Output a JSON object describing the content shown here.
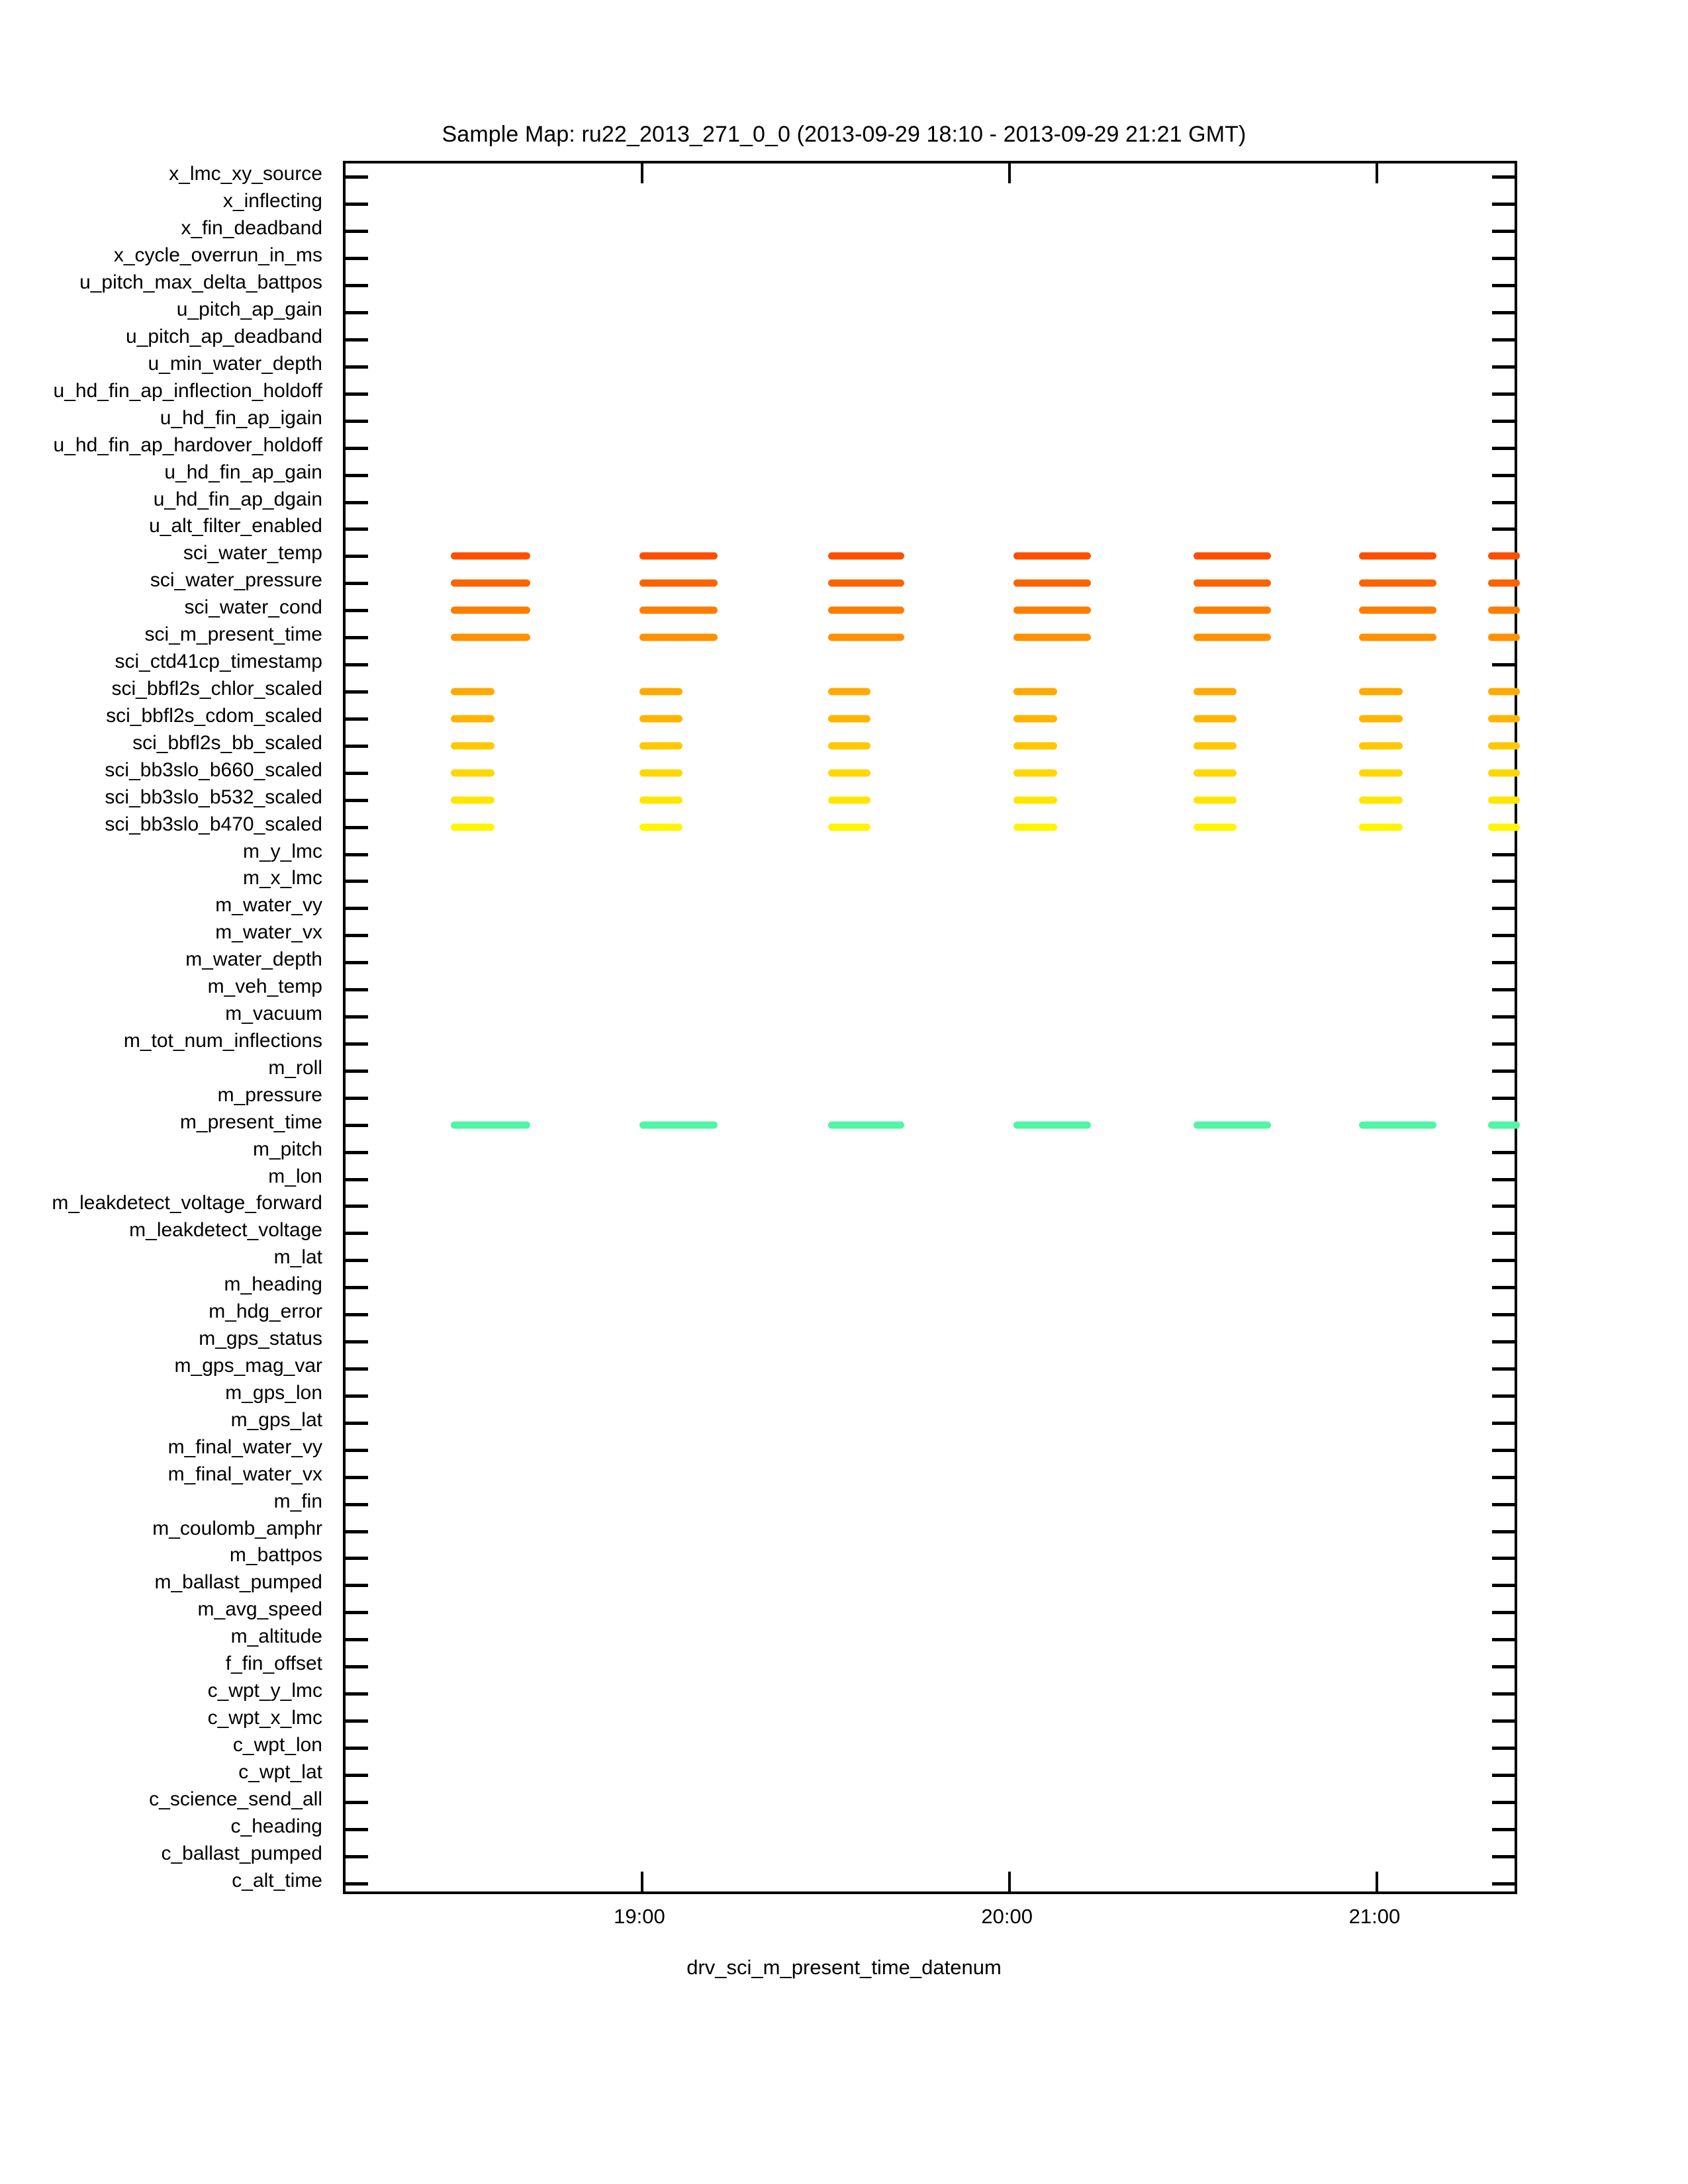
{
  "chart_data": {
    "type": "heatmap",
    "title": "Sample Map: ru22_2013_271_0_0 (2013-09-29 18:10 - 2013-09-29 21:21 GMT)",
    "xlabel": "drv_sci_m_present_time_datenum",
    "ylabel": "",
    "grid": false,
    "legend": "none",
    "xlim": [
      "18:10",
      "21:21"
    ],
    "xticks": [
      "19:00",
      "20:00",
      "21:00"
    ],
    "xtick_positions_frac": [
      0.2525,
      0.5655,
      0.8785
    ],
    "categories": [
      "x_lmc_xy_source",
      "x_inflecting",
      "x_fin_deadband",
      "x_cycle_overrun_in_ms",
      "u_pitch_max_delta_battpos",
      "u_pitch_ap_gain",
      "u_pitch_ap_deadband",
      "u_min_water_depth",
      "u_hd_fin_ap_inflection_holdoff",
      "u_hd_fin_ap_igain",
      "u_hd_fin_ap_hardover_holdoff",
      "u_hd_fin_ap_gain",
      "u_hd_fin_ap_dgain",
      "u_alt_filter_enabled",
      "sci_water_temp",
      "sci_water_pressure",
      "sci_water_cond",
      "sci_m_present_time",
      "sci_ctd41cp_timestamp",
      "sci_bbfl2s_chlor_scaled",
      "sci_bbfl2s_cdom_scaled",
      "sci_bbfl2s_bb_scaled",
      "sci_bb3slo_b660_scaled",
      "sci_bb3slo_b532_scaled",
      "sci_bb3slo_b470_scaled",
      "m_y_lmc",
      "m_x_lmc",
      "m_water_vy",
      "m_water_vx",
      "m_water_depth",
      "m_veh_temp",
      "m_vacuum",
      "m_tot_num_inflections",
      "m_roll",
      "m_pressure",
      "m_present_time",
      "m_pitch",
      "m_lon",
      "m_leakdetect_voltage_forward",
      "m_leakdetect_voltage",
      "m_lat",
      "m_heading",
      "m_hdg_error",
      "m_gps_status",
      "m_gps_mag_var",
      "m_gps_lon",
      "m_gps_lat",
      "m_final_water_vy",
      "m_final_water_vx",
      "m_fin",
      "m_coulomb_amphr",
      "m_battpos",
      "m_ballast_pumped",
      "m_avg_speed",
      "m_altitude",
      "f_fin_offset",
      "c_wpt_y_lmc",
      "c_wpt_x_lmc",
      "c_wpt_lon",
      "c_wpt_lat",
      "c_science_send_all",
      "c_heading",
      "c_ballast_pumped",
      "c_alt_time"
    ],
    "series": [
      {
        "name": "sci_water_temp",
        "row": 14,
        "color": "#FA5000",
        "segments": [
          [
            0.0898,
            0.157
          ],
          [
            0.25,
            0.317
          ],
          [
            0.411,
            0.476
          ],
          [
            0.569,
            0.635
          ],
          [
            0.722,
            0.788
          ],
          [
            0.863,
            0.929
          ],
          [
            0.973,
            1.0
          ]
        ]
      },
      {
        "name": "sci_water_pressure",
        "row": 15,
        "color": "#FA6400",
        "segments": [
          [
            0.0898,
            0.157
          ],
          [
            0.25,
            0.317
          ],
          [
            0.411,
            0.476
          ],
          [
            0.569,
            0.635
          ],
          [
            0.722,
            0.788
          ],
          [
            0.863,
            0.929
          ],
          [
            0.973,
            1.0
          ]
        ]
      },
      {
        "name": "sci_water_cond",
        "row": 16,
        "color": "#FC7D00",
        "segments": [
          [
            0.0898,
            0.157
          ],
          [
            0.25,
            0.317
          ],
          [
            0.411,
            0.476
          ],
          [
            0.569,
            0.635
          ],
          [
            0.722,
            0.788
          ],
          [
            0.863,
            0.929
          ],
          [
            0.973,
            1.0
          ]
        ]
      },
      {
        "name": "sci_m_present_time",
        "row": 17,
        "color": "#FF9000",
        "segments": [
          [
            0.0898,
            0.157
          ],
          [
            0.25,
            0.317
          ],
          [
            0.411,
            0.476
          ],
          [
            0.569,
            0.635
          ],
          [
            0.722,
            0.788
          ],
          [
            0.863,
            0.929
          ],
          [
            0.973,
            1.0
          ]
        ]
      },
      {
        "name": "sci_bbfl2s_chlor_scaled",
        "row": 19,
        "color": "#FFAA00",
        "segments": [
          [
            0.0898,
            0.127
          ],
          [
            0.25,
            0.287
          ],
          [
            0.411,
            0.447
          ],
          [
            0.569,
            0.606
          ],
          [
            0.722,
            0.759
          ],
          [
            0.863,
            0.9
          ],
          [
            0.973,
            1.0
          ]
        ]
      },
      {
        "name": "sci_bbfl2s_cdom_scaled",
        "row": 20,
        "color": "#FFB400",
        "segments": [
          [
            0.0898,
            0.127
          ],
          [
            0.25,
            0.287
          ],
          [
            0.411,
            0.447
          ],
          [
            0.569,
            0.606
          ],
          [
            0.722,
            0.759
          ],
          [
            0.863,
            0.9
          ],
          [
            0.973,
            1.0
          ]
        ]
      },
      {
        "name": "sci_bbfl2s_bb_scaled",
        "row": 21,
        "color": "#FFC800",
        "segments": [
          [
            0.0898,
            0.127
          ],
          [
            0.25,
            0.287
          ],
          [
            0.411,
            0.447
          ],
          [
            0.569,
            0.606
          ],
          [
            0.722,
            0.759
          ],
          [
            0.863,
            0.9
          ],
          [
            0.973,
            1.0
          ]
        ]
      },
      {
        "name": "sci_bb3slo_b660_scaled",
        "row": 22,
        "color": "#FFD700",
        "segments": [
          [
            0.0898,
            0.127
          ],
          [
            0.25,
            0.287
          ],
          [
            0.411,
            0.447
          ],
          [
            0.569,
            0.606
          ],
          [
            0.722,
            0.759
          ],
          [
            0.863,
            0.9
          ],
          [
            0.973,
            1.0
          ]
        ]
      },
      {
        "name": "sci_bb3slo_b532_scaled",
        "row": 23,
        "color": "#FFE600",
        "segments": [
          [
            0.0898,
            0.127
          ],
          [
            0.25,
            0.287
          ],
          [
            0.411,
            0.447
          ],
          [
            0.569,
            0.606
          ],
          [
            0.722,
            0.759
          ],
          [
            0.863,
            0.9
          ],
          [
            0.973,
            1.0
          ]
        ]
      },
      {
        "name": "sci_bb3slo_b470_scaled",
        "row": 24,
        "color": "#FFF500",
        "segments": [
          [
            0.0898,
            0.127
          ],
          [
            0.25,
            0.287
          ],
          [
            0.411,
            0.447
          ],
          [
            0.569,
            0.606
          ],
          [
            0.722,
            0.759
          ],
          [
            0.863,
            0.9
          ],
          [
            0.973,
            1.0
          ]
        ]
      },
      {
        "name": "m_present_time",
        "row": 35,
        "color": "#50F5A5",
        "segments": [
          [
            0.0898,
            0.157
          ],
          [
            0.25,
            0.317
          ],
          [
            0.411,
            0.476
          ],
          [
            0.569,
            0.635
          ],
          [
            0.722,
            0.788
          ],
          [
            0.863,
            0.929
          ],
          [
            0.973,
            1.0
          ]
        ]
      }
    ]
  }
}
